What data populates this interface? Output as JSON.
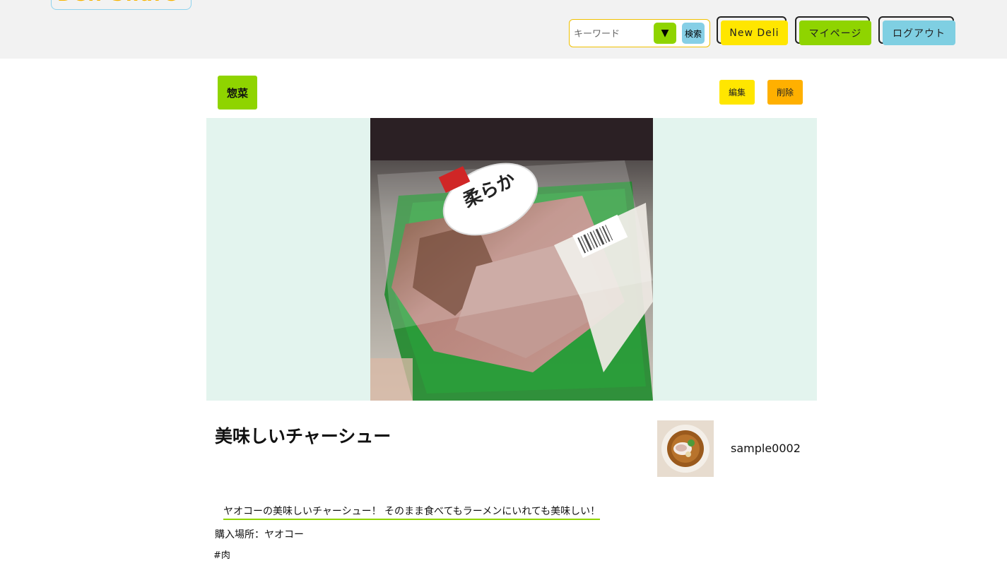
{
  "header": {
    "logo_text": "Deli Share",
    "search": {
      "placeholder": "キーワード",
      "value": "",
      "dropdown_icon": "triangle-down-icon",
      "button_label": "検索"
    },
    "nav": {
      "new_deli": "New Deli",
      "mypage": "マイページ",
      "logout": "ログアウト"
    }
  },
  "post": {
    "category": "惣菜",
    "edit_label": "編集",
    "delete_label": "削除",
    "photo_label_text": "柔らか",
    "title": "美味しいチャーシュー",
    "author": "sample0002",
    "description": "ヤオコーの美味しいチャーシュー！ そのまま食べてもラーメンにいれても美味しい！",
    "place": "購入場所：ヤオコー",
    "tags": [
      "#肉"
    ]
  },
  "colors": {
    "header_bg": "#f2f2f2",
    "green": "#8fd400",
    "yellow": "#ffe600",
    "orange": "#ffb000",
    "blue": "#7fcfe2",
    "image_bg": "#e3f4ee"
  }
}
